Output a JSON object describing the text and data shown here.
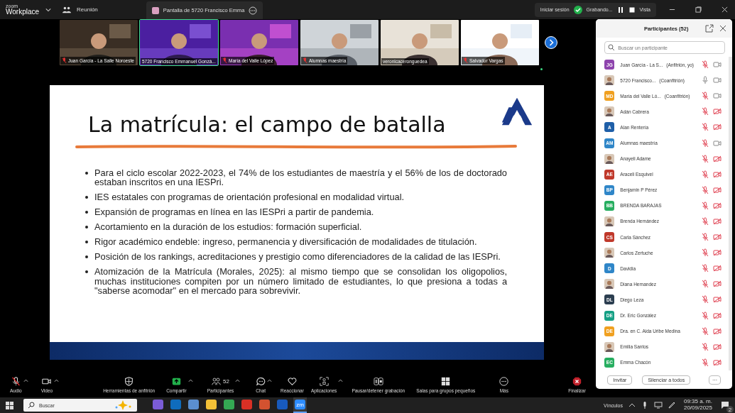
{
  "app": {
    "brand_top": "zoom",
    "brand": "Workplace",
    "meeting_menu": "Reunión",
    "share_tab": "Pantalla de 5720 Francisco Emma",
    "sign_in": "Iniciar sesión",
    "recording": "Grabando...",
    "view": "Vista"
  },
  "video_tiles": [
    {
      "name": "Juan García - La Salle Noroeste",
      "mic_muted": true,
      "selected": false
    },
    {
      "name": "5720 Francisco Emmanuel Gonzá...",
      "mic_muted": false,
      "selected": true
    },
    {
      "name": "María del Valle López",
      "mic_muted": true,
      "selected": false
    },
    {
      "name": "Alumnas maestría",
      "mic_muted": true,
      "selected": false
    },
    {
      "name": "veronicaceronguedea",
      "mic_muted": false,
      "selected": false
    },
    {
      "name": "Salvador Vargas",
      "mic_muted": true,
      "selected": false
    }
  ],
  "slide": {
    "title": "La matrícula: el campo de batalla",
    "bullets": [
      "Para el ciclo escolar 2022-2023, el 74% de los estudiantes de maestría y el 56% de los de doctorado estaban inscritos en una IESPri.",
      "IES estatales con programas de orientación profesional en modalidad virtual.",
      "Expansión de programas en línea en las IESPri a partir de pandemia.",
      "Acortamiento en la duración de los estudios: formación superficial.",
      "Rigor académico endeble: ingreso, permanencia y diversificación de modalidades de titulación.",
      "Posición de los rankings, acreditaciones y prestigio como diferenciadores de la calidad de las IESPri.",
      "Atomización de la Matrícula (Morales, 2025): al mismo tiempo que se consolidan los oligopolios, muchas instituciones compiten por un número limitado de estudiantes, lo que presiona a todas a \"saberse acomodar\" en el mercado para sobrevivir."
    ]
  },
  "participants": {
    "title": "Participantes (52)",
    "search_placeholder": "Buscar un participante",
    "items": [
      {
        "name": "Juan García - La S...",
        "role": "(Anfitrión, yo)",
        "initials": "JG",
        "color": "#8e44ad",
        "mic_muted": true,
        "video_off": false
      },
      {
        "name": "5720 Francisco...",
        "role": "(Coanfitrión)",
        "mic_muted": false,
        "video_off": false
      },
      {
        "name": "María del Valle Ló...",
        "role": "(Coanfitrión)",
        "initials": "MD",
        "color": "#f0a020",
        "mic_muted": true,
        "video_off": false
      },
      {
        "name": "Adán Cabrera",
        "mic_muted": true,
        "video_off": true
      },
      {
        "name": "Alan Rentería",
        "initials": "A",
        "color": "#1f5fa8",
        "mic_muted": true,
        "video_off": true
      },
      {
        "name": "Alumnas maestría",
        "initials": "AM",
        "color": "#2f86c8",
        "mic_muted": true,
        "video_off": false
      },
      {
        "name": "Anayeli Adame",
        "mic_muted": true,
        "video_off": true
      },
      {
        "name": "Araceli Esquivel",
        "initials": "AE",
        "color": "#c0392b",
        "mic_muted": true,
        "video_off": true
      },
      {
        "name": "Benjamin P Pérez",
        "initials": "BP",
        "color": "#2f86c8",
        "mic_muted": true,
        "video_off": true
      },
      {
        "name": "BRENDA BARAJAS",
        "initials": "BB",
        "color": "#27ae60",
        "mic_muted": true,
        "video_off": true
      },
      {
        "name": "Brenda Hernández",
        "mic_muted": true,
        "video_off": true
      },
      {
        "name": "Carla Sánchez",
        "initials": "CS",
        "color": "#c0392b",
        "mic_muted": true,
        "video_off": true
      },
      {
        "name": "Carlos Zertuche",
        "mic_muted": true,
        "video_off": true
      },
      {
        "name": "Davidia",
        "initials": "D",
        "color": "#2f86c8",
        "mic_muted": true,
        "video_off": true
      },
      {
        "name": "Diana Hernandez",
        "mic_muted": true,
        "video_off": true
      },
      {
        "name": "Diego Leza",
        "initials": "DL",
        "color": "#2c3e50",
        "mic_muted": true,
        "video_off": true
      },
      {
        "name": "Dr. Eric González",
        "initials": "DE",
        "color": "#16a085",
        "mic_muted": true,
        "video_off": true
      },
      {
        "name": "Dra. en C. Aida Uribe Medina",
        "initials": "DE",
        "color": "#f0a020",
        "mic_muted": true,
        "video_off": true
      },
      {
        "name": "Emilia Santos",
        "mic_muted": true,
        "video_off": true
      },
      {
        "name": "Emma Chacón",
        "initials": "EC",
        "color": "#27ae60",
        "mic_muted": true,
        "video_off": true
      }
    ],
    "buttons": [
      "Invitar",
      "Silenciar a todos",
      "···"
    ]
  },
  "toolbar": [
    {
      "kind": "mic",
      "label": "Audio",
      "caret": true,
      "muted": true
    },
    {
      "kind": "camera",
      "label": "Video",
      "caret": true
    },
    {
      "kind": "shield",
      "label": "Herramientas de anfitrión",
      "caret": false
    },
    {
      "kind": "share",
      "label": "Compartir",
      "caret": true
    },
    {
      "kind": "people",
      "label": "Participantes",
      "caret": true,
      "count": "52"
    },
    {
      "kind": "chat",
      "label": "Chat",
      "caret": true
    },
    {
      "kind": "heart",
      "label": "Reaccionar",
      "caret": false
    },
    {
      "kind": "apps",
      "label": "Aplicaciones",
      "caret": true
    },
    {
      "kind": "record",
      "label": "Pausar/detener grabación",
      "caret": false
    },
    {
      "kind": "rooms",
      "label": "Salas para grupos pequeños",
      "caret": false
    },
    {
      "kind": "more",
      "label": "Más",
      "caret": false
    },
    {
      "kind": "end",
      "label": "Finalizar",
      "caret": false
    }
  ],
  "taskbar": {
    "search_placeholder": "Buscar",
    "apps": [
      {
        "color": "#7b5cd6",
        "selected": false
      },
      {
        "color": "#0f6cbd",
        "selected": false
      },
      {
        "color": "#5b8fd0",
        "selected": false
      },
      {
        "color": "#f2c037",
        "selected": false
      },
      {
        "color": "#34a853",
        "selected": false
      },
      {
        "color": "#d93025",
        "selected": false
      },
      {
        "color": "#d35230",
        "selected": false
      },
      {
        "color": "#185abd",
        "selected": false
      },
      {
        "color": "#2d8cff",
        "selected": true,
        "label": "zm"
      }
    ],
    "links": "Vínculos",
    "time": "09:35 a. m.",
    "date": "20/09/2025",
    "notifications": "2"
  }
}
